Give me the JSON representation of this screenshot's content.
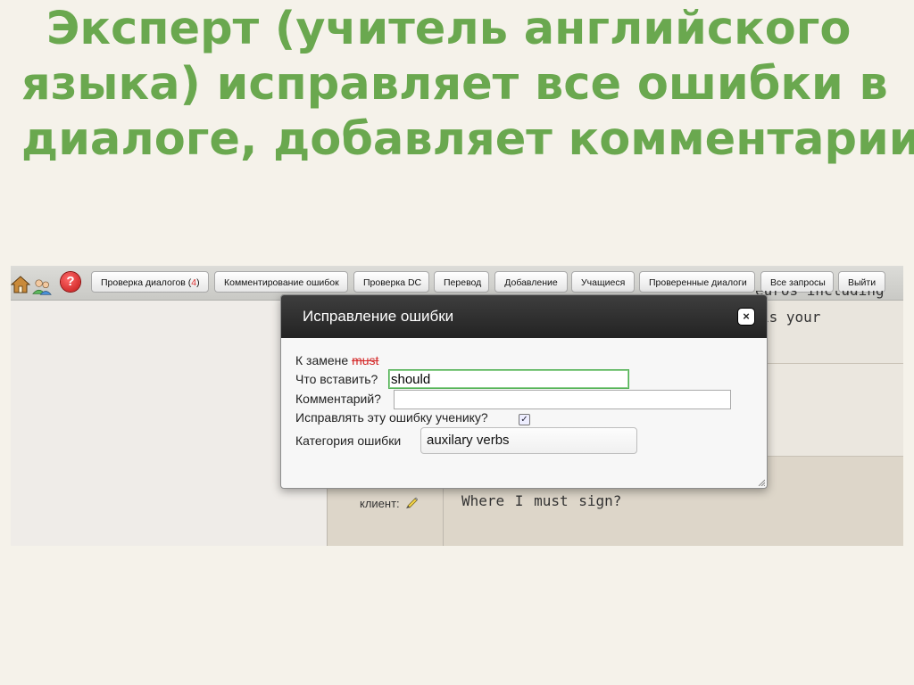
{
  "slide": {
    "title_line1": "Эксперт (учитель английского",
    "title_line2": "языка) исправляет все ошибки в",
    "title_line3": "диалоге, добавляет комментарии"
  },
  "toolbar": {
    "icons": [
      "home-icon",
      "users-icon",
      "help-icon"
    ],
    "help_glyph": "?",
    "buttons": [
      {
        "label": "Проверка диалогов (",
        "count": "4",
        "suffix": ")"
      },
      {
        "label": "Комментирование ошибок"
      },
      {
        "label": "Проверка DC"
      },
      {
        "label": "Перевод"
      },
      {
        "label": "Добавление"
      },
      {
        "label": "Учащиеся"
      },
      {
        "label": "Проверенные диалоги"
      },
      {
        "label": "Все запросы"
      },
      {
        "label": "Выйти"
      }
    ]
  },
  "background": {
    "fragment_line1": "euros including",
    "fragment_line2": "is your",
    "speaker_label": "клиент:",
    "message": "Where I must sign?"
  },
  "dialog": {
    "title": "Исправление ошибки",
    "close_glyph": "×",
    "replace_label": "К замене",
    "replace_value": "must",
    "insert_label": "Что вставить?",
    "insert_value": "should",
    "comment_label": "Комментарий?",
    "comment_value": "",
    "fix_label": "Исправлять эту ошибку ученику?",
    "fix_checked": true,
    "check_glyph": "✓",
    "category_label": "Категория ошибки",
    "category_value": "auxilary verbs"
  },
  "colors": {
    "title_green": "#6aa84f",
    "count_red": "#dd3333",
    "strike_red": "#d42a2a",
    "dialog_header": "#2b2b2b"
  }
}
